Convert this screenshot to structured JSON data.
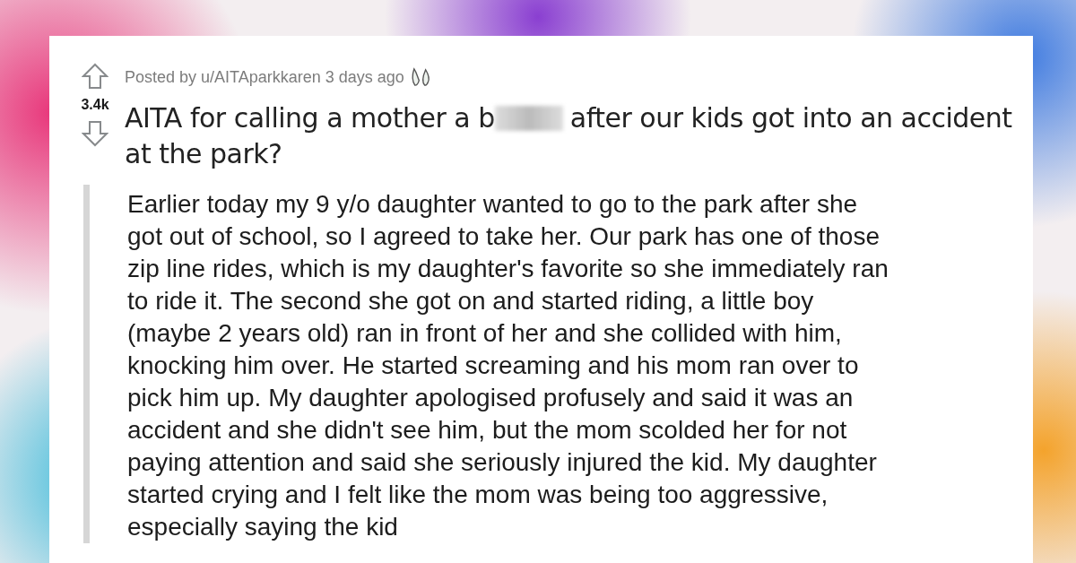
{
  "post": {
    "score": "3.4k",
    "meta": "Posted by u/AITAparkkaren 3 days ago",
    "title_start": "AITA for calling a mother a b",
    "title_end": "after our kids got into an accident",
    "title_line_2": "at the park?",
    "body": "Earlier today my 9 y/o daughter wanted to go to the park after she got out of school, so I agreed to take her. Our park has one of those zip line rides, which is my daughter's favorite so she immediately ran to ride it. The second she got on and started riding, a little boy (maybe 2 years old) ran in front of her and she collided with him, knocking him over. He started screaming and his mom ran over to pick him up. My daughter apologised profusely and said it was an accident and she didn't see him, but the mom scolded her for not paying attention and said she seriously injured the kid. My daughter started crying and I felt like the mom was being too aggressive, especially saying the kid"
  }
}
